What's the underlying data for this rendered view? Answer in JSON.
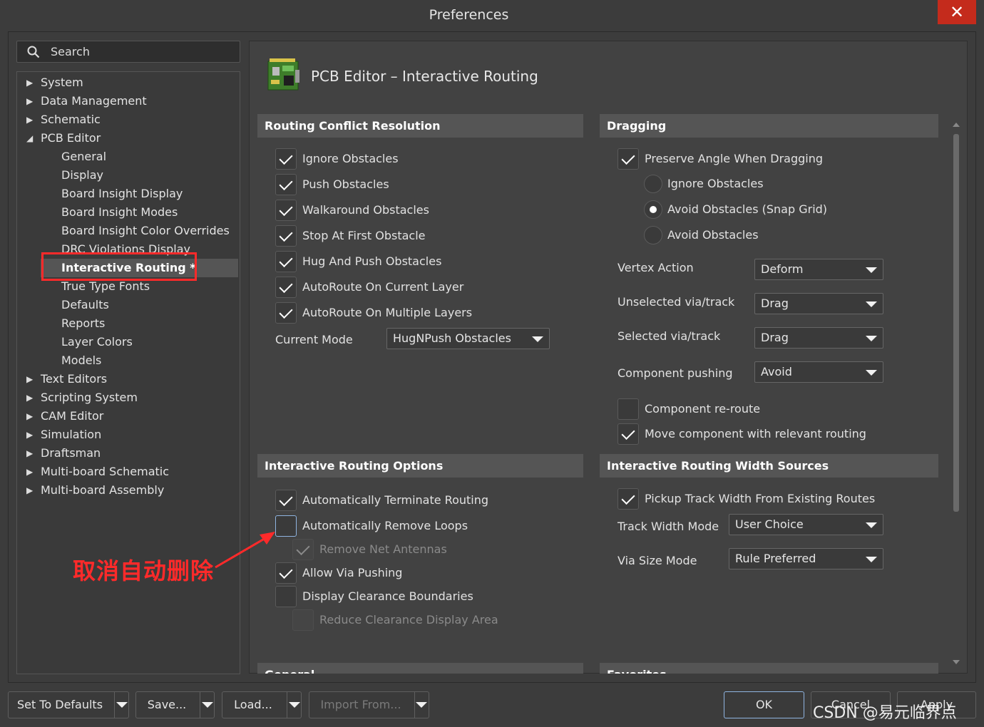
{
  "window": {
    "title": "Preferences",
    "close_glyph": "✕"
  },
  "search": {
    "placeholder": "Search",
    "icon": "search-icon"
  },
  "tree": {
    "top_items": [
      "System",
      "Data Management",
      "Schematic",
      "PCB Editor"
    ],
    "pcb_children": [
      "General",
      "Display",
      "Board Insight Display",
      "Board Insight Modes",
      "Board Insight Color Overrides",
      "DRC Violations Display",
      "Interactive Routing *",
      "True Type Fonts",
      "Defaults",
      "Reports",
      "Layer Colors",
      "Models"
    ],
    "bottom_items": [
      "Text Editors",
      "Scripting System",
      "CAM Editor",
      "Simulation",
      "Draftsman",
      "Multi-board Schematic",
      "Multi-board Assembly"
    ],
    "selected": "Interactive Routing *"
  },
  "page": {
    "title": "PCB Editor – Interactive Routing",
    "icon": "pcb-board-icon"
  },
  "rcr": {
    "header": "Routing Conflict Resolution",
    "items": [
      {
        "label": "Ignore Obstacles",
        "checked": true
      },
      {
        "label": "Push Obstacles",
        "checked": true
      },
      {
        "label": "Walkaround Obstacles",
        "checked": true
      },
      {
        "label": "Stop At First Obstacle",
        "checked": true
      },
      {
        "label": "Hug And Push Obstacles",
        "checked": true
      },
      {
        "label": "AutoRoute On Current Layer",
        "checked": true
      },
      {
        "label": "AutoRoute On Multiple Layers",
        "checked": true
      }
    ],
    "mode_label": "Current Mode",
    "mode_value": "HugNPush Obstacles"
  },
  "drag": {
    "header": "Dragging",
    "preserve_label": "Preserve Angle When Dragging",
    "radios": [
      {
        "label": "Ignore Obstacles",
        "selected": false
      },
      {
        "label": "Avoid Obstacles (Snap Grid)",
        "selected": true
      },
      {
        "label": "Avoid Obstacles",
        "selected": false
      }
    ],
    "rows": [
      {
        "label": "Vertex Action",
        "value": "Deform"
      },
      {
        "label": "Unselected via/track",
        "value": "Drag"
      },
      {
        "label": "Selected via/track",
        "value": "Drag"
      },
      {
        "label": "Component pushing",
        "value": "Avoid"
      }
    ],
    "reroute_label": "Component re-route",
    "move_label": "Move component with relevant routing"
  },
  "iro": {
    "header": "Interactive Routing Options",
    "items": [
      {
        "label": "Automatically Terminate Routing",
        "checked": true
      },
      {
        "label": "Automatically Remove Loops",
        "checked": false
      },
      {
        "label": "Remove Net Antennas",
        "checked": true
      },
      {
        "label": "Allow Via Pushing",
        "checked": true
      },
      {
        "label": "Display Clearance Boundaries",
        "checked": false
      },
      {
        "label": "Reduce Clearance Display Area",
        "checked": false
      }
    ]
  },
  "irws": {
    "header": "Interactive Routing Width Sources",
    "pickup_label": "Pickup Track Width From Existing Routes",
    "track_label": "Track Width Mode",
    "track_value": "User Choice",
    "via_label": "Via Size Mode",
    "via_value": "Rule Preferred"
  },
  "partial_headers": {
    "left": "General",
    "right": "Favorites"
  },
  "footer": {
    "defaults": "Set To Defaults",
    "save": "Save...",
    "load": "Load...",
    "import": "Import From...",
    "ok": "OK",
    "cancel": "Cancel",
    "apply": "Apply"
  },
  "annotation": {
    "text": "取消自动删除"
  },
  "watermark": "CSDN @易元临界点",
  "colors": {
    "highlight": "#ff2a2a",
    "selection": "#555555",
    "focus": "#8fb4e0"
  }
}
